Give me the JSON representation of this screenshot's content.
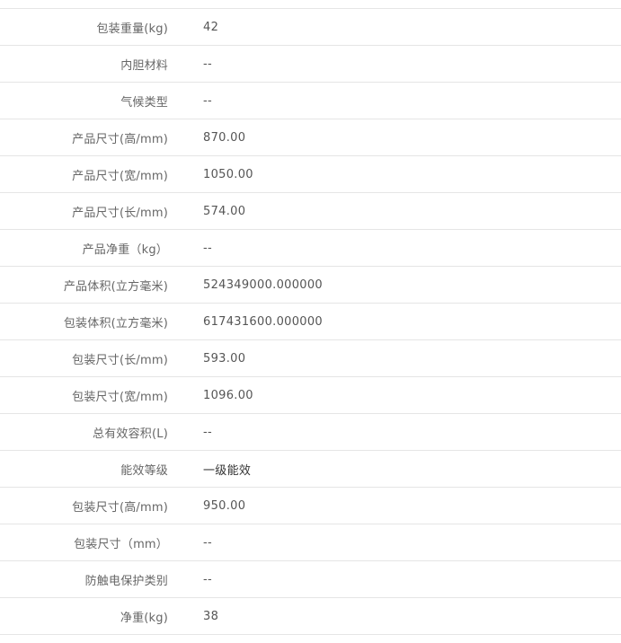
{
  "specs": [
    {
      "label": "包装重量(kg)",
      "value": "42"
    },
    {
      "label": "内胆材料",
      "value": "--"
    },
    {
      "label": "气候类型",
      "value": "--"
    },
    {
      "label": "产品尺寸(高/mm)",
      "value": "870.00"
    },
    {
      "label": "产品尺寸(宽/mm)",
      "value": "1050.00"
    },
    {
      "label": "产品尺寸(长/mm)",
      "value": "574.00"
    },
    {
      "label": "产品净重（kg）",
      "value": "--"
    },
    {
      "label": "产品体积(立方毫米)",
      "value": "524349000.000000"
    },
    {
      "label": "包装体积(立方毫米)",
      "value": "617431600.000000"
    },
    {
      "label": "包装尺寸(长/mm)",
      "value": "593.00"
    },
    {
      "label": "包装尺寸(宽/mm)",
      "value": "1096.00"
    },
    {
      "label": "总有效容积(L)",
      "value": "--"
    },
    {
      "label": "能效等级",
      "value": "一级能效"
    },
    {
      "label": "包装尺寸(高/mm)",
      "value": "950.00"
    },
    {
      "label": "包装尺寸（mm）",
      "value": "--"
    },
    {
      "label": "防触电保护类别",
      "value": "--"
    },
    {
      "label": "净重(kg)",
      "value": "38"
    }
  ]
}
